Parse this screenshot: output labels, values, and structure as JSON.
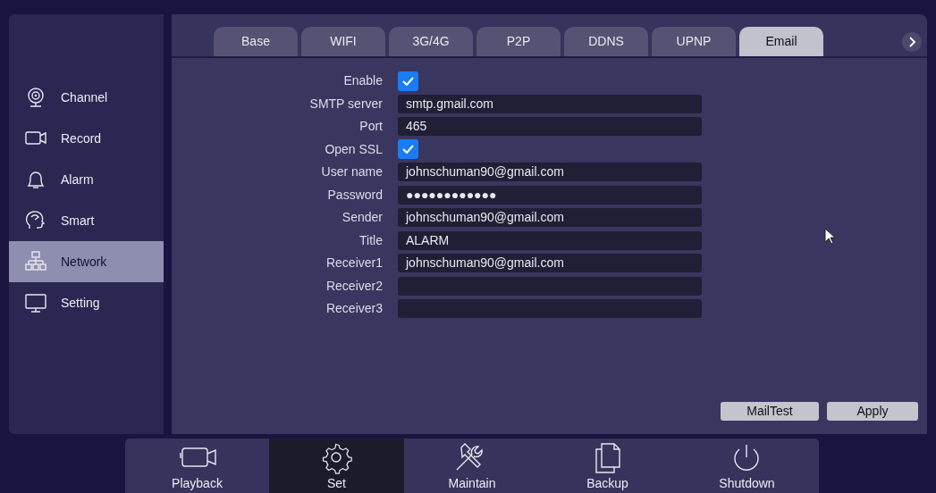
{
  "sidebar": {
    "items": [
      {
        "label": "Channel",
        "selected": false
      },
      {
        "label": "Record",
        "selected": false
      },
      {
        "label": "Alarm",
        "selected": false
      },
      {
        "label": "Smart",
        "selected": false
      },
      {
        "label": "Network",
        "selected": true
      },
      {
        "label": "Setting",
        "selected": false
      }
    ]
  },
  "tabs": [
    {
      "label": "Base",
      "selected": false
    },
    {
      "label": "WIFI",
      "selected": false
    },
    {
      "label": "3G/4G",
      "selected": false
    },
    {
      "label": "P2P",
      "selected": false
    },
    {
      "label": "DDNS",
      "selected": false
    },
    {
      "label": "UPNP",
      "selected": false
    },
    {
      "label": "Email",
      "selected": true
    }
  ],
  "form": {
    "fields": [
      {
        "label": "Enable",
        "kind": "checkbox",
        "checked": true
      },
      {
        "label": "SMTP server",
        "kind": "text",
        "value": "smtp.gmail.com"
      },
      {
        "label": "Port",
        "kind": "text",
        "value": "465"
      },
      {
        "label": "Open SSL",
        "kind": "checkbox",
        "checked": true
      },
      {
        "label": "User name",
        "kind": "text",
        "value": "johnschuman90@gmail.com"
      },
      {
        "label": "Password",
        "kind": "text",
        "value": "●●●●●●●●●●●●"
      },
      {
        "label": "Sender",
        "kind": "text",
        "value": "johnschuman90@gmail.com"
      },
      {
        "label": "Title",
        "kind": "text",
        "value": "ALARM"
      },
      {
        "label": "Receiver1",
        "kind": "text",
        "value": "johnschuman90@gmail.com"
      },
      {
        "label": "Receiver2",
        "kind": "text"
      },
      {
        "label": "Receiver3",
        "kind": "text"
      }
    ]
  },
  "buttons": [
    "MailTest",
    "Apply"
  ],
  "bottom_nav": [
    {
      "label": "Playback",
      "selected": false
    },
    {
      "label": "Set",
      "selected": true
    },
    {
      "label": "Maintain",
      "selected": false
    },
    {
      "label": "Backup",
      "selected": false
    },
    {
      "label": "Shutdown",
      "selected": false
    }
  ]
}
